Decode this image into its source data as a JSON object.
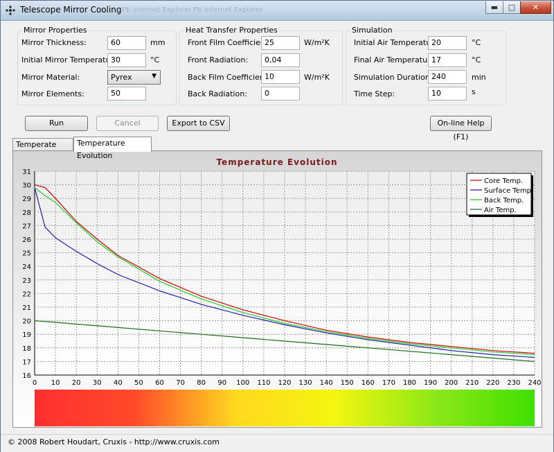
{
  "window": {
    "title": "Telescope Mirror Cooling",
    "ghost_tabs": "Pb Internet Explorer   Pb Internet Explorer"
  },
  "mirror_properties": {
    "title": "Mirror Properties",
    "thickness_label": "Mirror Thickness:",
    "thickness_value": "60",
    "thickness_unit": "mm",
    "initial_temp_label": "Initial Mirror Temperature:",
    "initial_temp_value": "30",
    "initial_temp_unit": "°C",
    "material_label": "Mirror Material:",
    "material_value": "Pyrex",
    "elements_label": "Mirror Elements:",
    "elements_value": "50"
  },
  "heat_transfer": {
    "title": "Heat Transfer Properties",
    "front_film_label": "Front Film Coefficient:",
    "front_film_value": "25",
    "front_film_unit": "W/m²K",
    "front_rad_label": "Front Radiation:",
    "front_rad_value": "0,04",
    "back_film_label": "Back Film Coefficient:",
    "back_film_value": "10",
    "back_film_unit": "W/m²K",
    "back_rad_label": "Back Radiation:",
    "back_rad_value": "0"
  },
  "simulation": {
    "title": "Simulation",
    "init_air_label": "Initial Air Temperature:",
    "init_air_value": "20",
    "init_air_unit": "°C",
    "final_air_label": "Final Air Temperature:",
    "final_air_value": "17",
    "final_air_unit": "°C",
    "duration_label": "Simulation Duration:",
    "duration_value": "240",
    "duration_unit": "min",
    "timestep_label": "Time Step:",
    "timestep_value": "10",
    "timestep_unit": "s"
  },
  "buttons": {
    "run": "Run",
    "cancel": "Cancel",
    "export": "Export to CSV",
    "help": "On-line Help (F1)"
  },
  "tabs": {
    "profile": "Temperate Profile",
    "evolution": "Temperature Evolution"
  },
  "status": {
    "text": "© 2008 Robert Houdart, Cruxis  -  http://www.cruxis.com"
  },
  "chart_data": {
    "type": "line",
    "title": "Temperature Evolution",
    "xlim": [
      0,
      240
    ],
    "ylim": [
      16,
      31
    ],
    "xticks": [
      0,
      10,
      20,
      30,
      40,
      50,
      60,
      70,
      80,
      90,
      100,
      110,
      120,
      130,
      140,
      150,
      160,
      170,
      180,
      190,
      200,
      210,
      220,
      230,
      240
    ],
    "yticks": [
      16,
      17,
      18,
      19,
      20,
      21,
      22,
      23,
      24,
      25,
      26,
      27,
      28,
      29,
      30,
      31
    ],
    "grid": true,
    "legend_position": "top-right",
    "x": [
      0,
      5,
      10,
      20,
      30,
      40,
      60,
      80,
      100,
      120,
      140,
      160,
      180,
      200,
      220,
      240
    ],
    "series": [
      {
        "name": "Core Temp.",
        "color": "#cc0000",
        "values": [
          30.0,
          29.8,
          29.0,
          27.3,
          26.0,
          24.8,
          23.1,
          21.8,
          20.8,
          20.0,
          19.3,
          18.8,
          18.4,
          18.1,
          17.8,
          17.6
        ]
      },
      {
        "name": "Surface Temp.",
        "color": "#1f1fb0",
        "values": [
          29.8,
          26.9,
          26.1,
          25.1,
          24.2,
          23.4,
          22.2,
          21.2,
          20.4,
          19.7,
          19.1,
          18.6,
          18.2,
          17.8,
          17.5,
          17.3
        ]
      },
      {
        "name": "Back Temp.",
        "color": "#22cc22",
        "values": [
          29.8,
          29.2,
          28.7,
          27.2,
          25.8,
          24.7,
          22.9,
          21.6,
          20.6,
          19.8,
          19.2,
          18.7,
          18.3,
          18.0,
          17.7,
          17.5
        ]
      },
      {
        "name": "Air Temp.",
        "color": "#1a6e1a",
        "values": [
          20.0,
          19.94,
          19.88,
          19.75,
          19.63,
          19.5,
          19.25,
          19.0,
          18.75,
          18.5,
          18.25,
          18.0,
          17.75,
          17.5,
          17.25,
          17.0
        ]
      }
    ],
    "colorbar_colors": [
      "#ff3030",
      "#ff4a2a",
      "#ffd820",
      "#f4f610",
      "#8de818",
      "#3ee000"
    ]
  }
}
